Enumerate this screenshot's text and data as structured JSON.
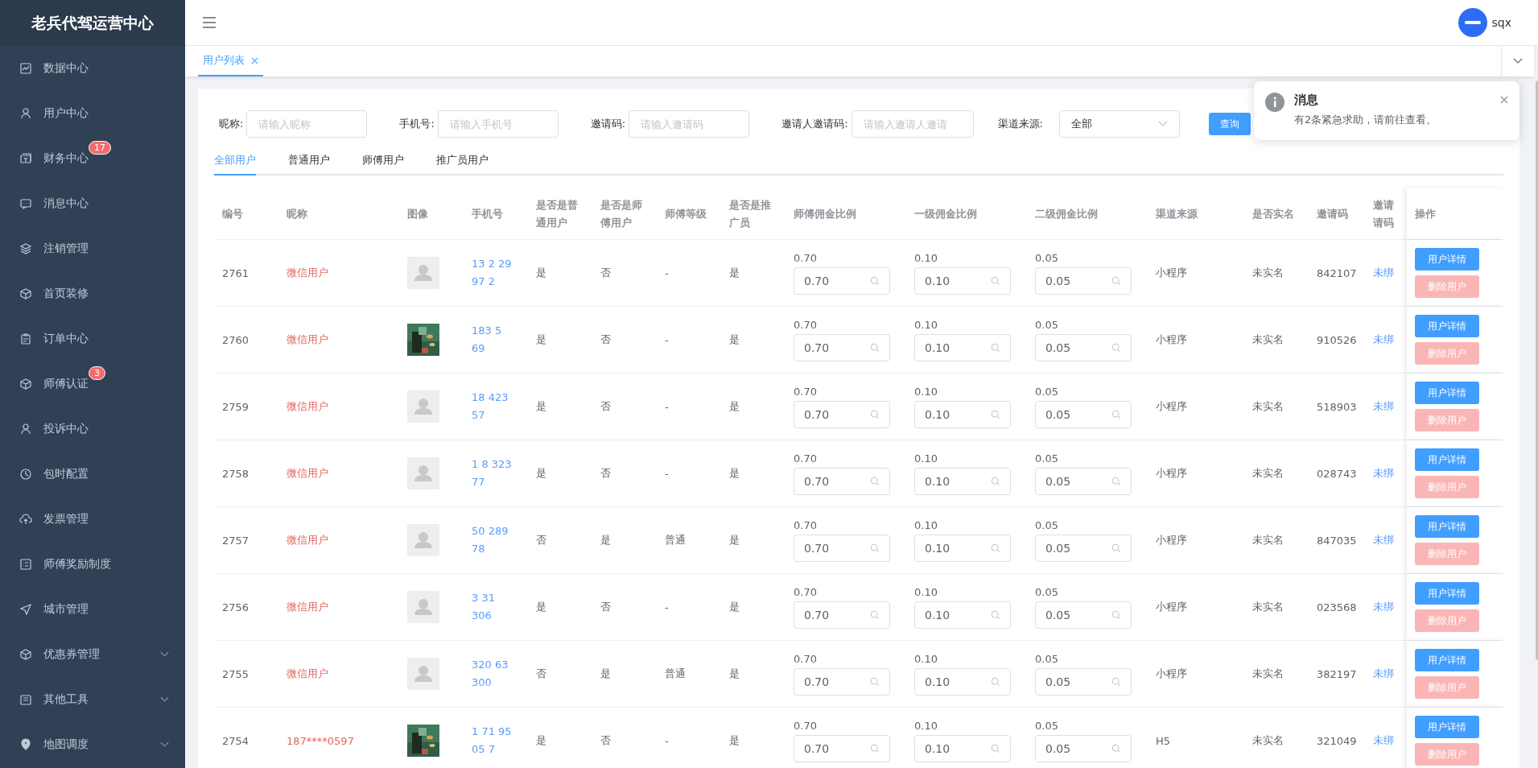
{
  "sidebar": {
    "title": "老兵代驾运营中心",
    "items": [
      {
        "label": "数据中心",
        "expandable": false
      },
      {
        "label": "用户中心",
        "expandable": false
      },
      {
        "label": "财务中心",
        "badge": "17",
        "expandable": false
      },
      {
        "label": "消息中心",
        "expandable": false
      },
      {
        "label": "注销管理",
        "expandable": false
      },
      {
        "label": "首页装修",
        "expandable": false
      },
      {
        "label": "订单中心",
        "expandable": false
      },
      {
        "label": "师傅认证",
        "badge": "3",
        "expandable": false
      },
      {
        "label": "投诉中心",
        "expandable": false
      },
      {
        "label": "包时配置",
        "expandable": false
      },
      {
        "label": "发票管理",
        "expandable": false
      },
      {
        "label": "师傅奖励制度",
        "expandable": false
      },
      {
        "label": "城市管理",
        "expandable": false
      },
      {
        "label": "优惠券管理",
        "expandable": true
      },
      {
        "label": "其他工具",
        "expandable": true
      },
      {
        "label": "地图调度",
        "expandable": true
      }
    ]
  },
  "header": {
    "user": "sqx"
  },
  "page_tabs": [
    {
      "label": "用户列表",
      "selected": true
    }
  ],
  "filters": [
    {
      "label": "昵称:",
      "placeholder": "请输入昵称"
    },
    {
      "label": "手机号:",
      "placeholder": "请输入手机号"
    },
    {
      "label": "邀请码:",
      "placeholder": "请输入邀请码"
    },
    {
      "label": "邀请人邀请码:",
      "placeholder": "请输入邀请人邀请"
    }
  ],
  "channel_filter": {
    "label": "渠道来源:",
    "value": "全部"
  },
  "search_button": "查询",
  "notification": {
    "title": "消息",
    "text": "有2条紧急求助，请前往查看。"
  },
  "user_tabs": [
    {
      "label": "全部用户",
      "selected": true
    },
    {
      "label": "普通用户",
      "selected": false
    },
    {
      "label": "师傅用户",
      "selected": false
    },
    {
      "label": "推广员用户",
      "selected": false
    }
  ],
  "table": {
    "columns": [
      [
        "编号"
      ],
      [
        "昵称"
      ],
      [
        "图像"
      ],
      [
        "手机号"
      ],
      [
        "是否是普",
        "通用户"
      ],
      [
        "是否是师",
        "傅用户"
      ],
      [
        "师傅等级"
      ],
      [
        "是否是推",
        "广员"
      ],
      [
        "师傅佣金比例"
      ],
      [
        "一级佣金比例"
      ],
      [
        "二级佣金比例"
      ],
      [
        "渠道来源"
      ],
      [
        "是否实名"
      ],
      [
        "邀请码"
      ],
      [
        "邀请",
        "请码"
      ],
      [
        "操作"
      ]
    ],
    "rows": [
      {
        "id": "2761",
        "nickname": "微信用户",
        "kind": "placeholder",
        "phone": [
          "13 2 29",
          "97 2"
        ],
        "normal": "是",
        "master": "否",
        "level": "-",
        "promoter": "是",
        "ratios": [
          [
            "0.70",
            "0.70"
          ],
          [
            "0.10",
            "0.10"
          ],
          [
            "0.05",
            "0.05"
          ]
        ],
        "channel": "小程序",
        "realname": "未实名",
        "code": "842107",
        "inviter": "未绑",
        "detail_button": "用户详情",
        "delete_button": "删除用户"
      },
      {
        "id": "2760",
        "nickname": "微信用户",
        "kind": "picture",
        "phone": [
          "183 5",
          "69"
        ],
        "normal": "是",
        "master": "否",
        "level": "-",
        "promoter": "是",
        "ratios": [
          [
            "0.70",
            "0.70"
          ],
          [
            "0.10",
            "0.10"
          ],
          [
            "0.05",
            "0.05"
          ]
        ],
        "channel": "小程序",
        "realname": "未实名",
        "code": "910526",
        "inviter": "未绑",
        "detail_button": "用户详情",
        "delete_button": "删除用户"
      },
      {
        "id": "2759",
        "nickname": "微信用户",
        "kind": "placeholder",
        "phone": [
          "18 423",
          "57"
        ],
        "normal": "是",
        "master": "否",
        "level": "-",
        "promoter": "是",
        "ratios": [
          [
            "0.70",
            "0.70"
          ],
          [
            "0.10",
            "0.10"
          ],
          [
            "0.05",
            "0.05"
          ]
        ],
        "channel": "小程序",
        "realname": "未实名",
        "code": "518903",
        "inviter": "未绑",
        "detail_button": "用户详情",
        "delete_button": "删除用户"
      },
      {
        "id": "2758",
        "nickname": "微信用户",
        "kind": "placeholder",
        "phone": [
          "1 8 323",
          "77"
        ],
        "normal": "是",
        "master": "否",
        "level": "-",
        "promoter": "是",
        "ratios": [
          [
            "0.70",
            "0.70"
          ],
          [
            "0.10",
            "0.10"
          ],
          [
            "0.05",
            "0.05"
          ]
        ],
        "channel": "小程序",
        "realname": "未实名",
        "code": "028743",
        "inviter": "未绑",
        "detail_button": "用户详情",
        "delete_button": "删除用户"
      },
      {
        "id": "2757",
        "nickname": "微信用户",
        "kind": "placeholder",
        "phone": [
          "50 289",
          "78"
        ],
        "normal": "否",
        "master": "是",
        "level": "普通",
        "promoter": "是",
        "ratios": [
          [
            "0.70",
            "0.70"
          ],
          [
            "0.10",
            "0.10"
          ],
          [
            "0.05",
            "0.05"
          ]
        ],
        "channel": "小程序",
        "realname": "未实名",
        "code": "847035",
        "inviter": "未绑",
        "detail_button": "用户详情",
        "delete_button": "删除用户"
      },
      {
        "id": "2756",
        "nickname": "微信用户",
        "kind": "placeholder",
        "phone": [
          "3 31",
          "306"
        ],
        "normal": "是",
        "master": "否",
        "level": "-",
        "promoter": "是",
        "ratios": [
          [
            "0.70",
            "0.70"
          ],
          [
            "0.10",
            "0.10"
          ],
          [
            "0.05",
            "0.05"
          ]
        ],
        "channel": "小程序",
        "realname": "未实名",
        "code": "023568",
        "inviter": "未绑",
        "detail_button": "用户详情",
        "delete_button": "删除用户"
      },
      {
        "id": "2755",
        "nickname": "微信用户",
        "kind": "placeholder",
        "phone": [
          "320 63",
          "300"
        ],
        "normal": "否",
        "master": "是",
        "level": "普通",
        "promoter": "是",
        "ratios": [
          [
            "0.70",
            "0.70"
          ],
          [
            "0.10",
            "0.10"
          ],
          [
            "0.05",
            "0.05"
          ]
        ],
        "channel": "小程序",
        "realname": "未实名",
        "code": "382197",
        "inviter": "未绑",
        "detail_button": "用户详情",
        "delete_button": "删除用户"
      },
      {
        "id": "2754",
        "nickname": "187****0597",
        "kind": "picture",
        "phone": [
          "1 71 95",
          "05 7"
        ],
        "normal": "是",
        "master": "否",
        "level": "-",
        "promoter": "是",
        "ratios": [
          [
            "0.70",
            "0.70"
          ],
          [
            "0.10",
            "0.10"
          ],
          [
            "0.05",
            "0.05"
          ]
        ],
        "channel": "H5",
        "realname": "未实名",
        "code": "321049",
        "inviter": "未绑",
        "detail_button": "用户详情",
        "delete_button": "删除用户"
      }
    ]
  }
}
